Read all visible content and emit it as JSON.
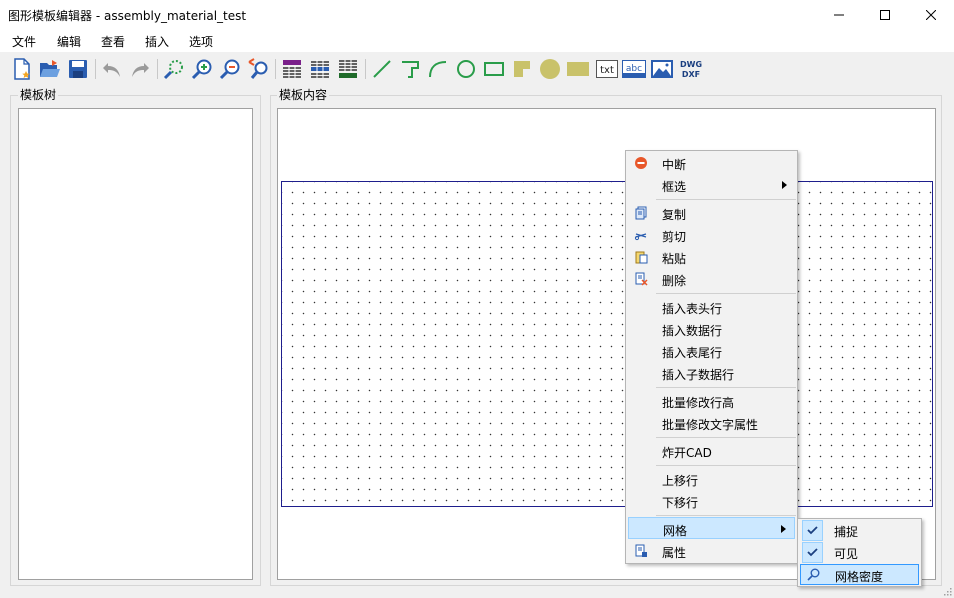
{
  "window": {
    "title": "图形模板编辑器 - assembly_material_test"
  },
  "menubar": {
    "items": [
      {
        "label": "文件"
      },
      {
        "label": "编辑"
      },
      {
        "label": "查看"
      },
      {
        "label": "插入"
      },
      {
        "label": "选项"
      }
    ]
  },
  "toolbar": {
    "icons": [
      "new-file-icon",
      "open-folder-icon",
      "save-icon",
      "undo-icon",
      "redo-icon",
      "zoom-fit-icon",
      "zoom-in-icon",
      "zoom-out-icon",
      "zoom-previous-icon",
      "table-header-icon",
      "table-rows-icon",
      "table-footer-icon",
      "line-icon",
      "polyline-icon",
      "arc-icon",
      "circle-icon",
      "rectangle-icon",
      "filled-polygon-icon",
      "filled-circle-icon",
      "filled-rectangle-icon",
      "text-icon",
      "text-field-icon",
      "image-icon",
      "dwg-dxf-icon"
    ],
    "text_icon_label": "txt",
    "text_field_label": "abc",
    "dwg_label": "DWG",
    "dxf_label": "DXF"
  },
  "left_panel": {
    "label": "模板树"
  },
  "right_panel": {
    "label": "模板内容"
  },
  "context_menu": {
    "items": [
      {
        "label": "中断",
        "icon": "stop-icon"
      },
      {
        "label": "框选",
        "submenu": true
      },
      {
        "label": "复制",
        "icon": "copy-icon"
      },
      {
        "label": "剪切",
        "icon": "cut-icon"
      },
      {
        "label": "粘贴",
        "icon": "paste-icon"
      },
      {
        "label": "删除",
        "icon": "delete-icon"
      },
      {
        "label": "插入表头行"
      },
      {
        "label": "插入数据行"
      },
      {
        "label": "插入表尾行"
      },
      {
        "label": "插入子数据行"
      },
      {
        "label": "批量修改行高"
      },
      {
        "label": "批量修改文字属性"
      },
      {
        "label": "炸开CAD"
      },
      {
        "label": "上移行"
      },
      {
        "label": "下移行"
      },
      {
        "label": "网格",
        "submenu": true,
        "highlighted": true
      },
      {
        "label": "属性",
        "icon": "properties-icon"
      }
    ]
  },
  "grid_submenu": {
    "items": [
      {
        "label": "捕捉",
        "checked": true
      },
      {
        "label": "可见",
        "checked": true
      },
      {
        "label": "网格密度",
        "icon": "search-icon",
        "highlighted": true
      }
    ]
  },
  "colors": {
    "accent_highlight": "#cce8ff",
    "highlight_border": "#99d1ff",
    "canvas_border": "#1e1e8c",
    "stop_icon": "#e8572a"
  }
}
